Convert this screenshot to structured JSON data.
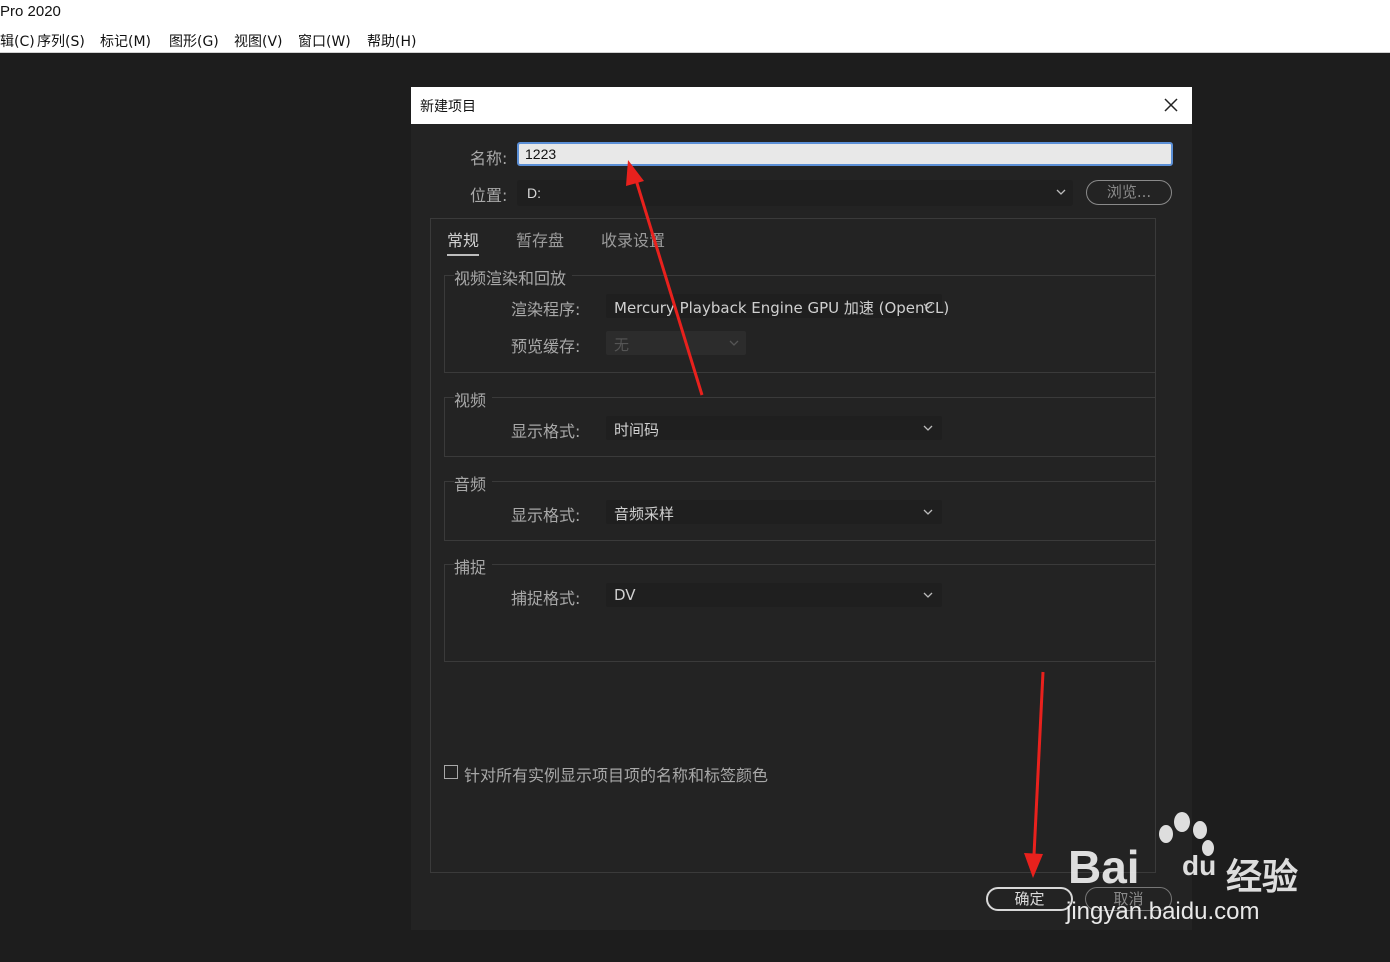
{
  "app": {
    "title": "Pro 2020"
  },
  "menubar": {
    "items": [
      {
        "label": "辑(C)"
      },
      {
        "label": "序列(S)"
      },
      {
        "label": "标记(M)"
      },
      {
        "label": "图形(G)"
      },
      {
        "label": "视图(V)"
      },
      {
        "label": "窗口(W)"
      },
      {
        "label": "帮助(H)"
      }
    ]
  },
  "dialog": {
    "title": "新建项目",
    "name_label": "名称:",
    "name_value": "1223",
    "location_label": "位置:",
    "location_value": "D:",
    "browse_label": "浏览...",
    "tabs": [
      {
        "label": "常规",
        "active": true
      },
      {
        "label": "暂存盘",
        "active": false
      },
      {
        "label": "收录设置",
        "active": false
      }
    ],
    "groups": {
      "render": {
        "title": "视频渲染和回放",
        "renderer_label": "渲染程序:",
        "renderer_value": "Mercury Playback Engine GPU 加速 (OpenCL)",
        "preview_cache_label": "预览缓存:",
        "preview_cache_value": "无"
      },
      "video": {
        "title": "视频",
        "format_label": "显示格式:",
        "format_value": "时间码"
      },
      "audio": {
        "title": "音频",
        "format_label": "显示格式:",
        "format_value": "音频采样"
      },
      "capture": {
        "title": "捕捉",
        "format_label": "捕捉格式:",
        "format_value": "DV"
      }
    },
    "checkbox_label": "针对所有实例显示项目项的名称和标签颜色",
    "checkbox_checked": false,
    "ok_label": "确定",
    "cancel_label": "取消"
  },
  "annotation": {
    "arrow_color": "#e8211d"
  },
  "watermark": {
    "brand": "Bai",
    "brand_du": "du",
    "suffix": "经验",
    "url": "jingyan.baidu.com"
  },
  "colors": {
    "dialog_bg": "#232323",
    "workspace_bg": "#1d1d1d",
    "focus_border": "#5b8fd6"
  }
}
